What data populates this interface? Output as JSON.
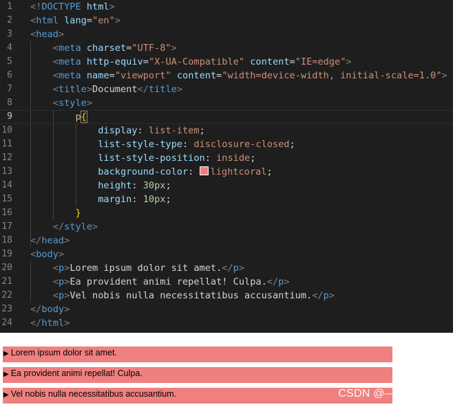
{
  "editor": {
    "lines": [
      {
        "n": "1",
        "tokens": [
          [
            "punct",
            "<!"
          ],
          [
            "tag",
            "DOCTYPE"
          ],
          [
            "txt",
            " "
          ],
          [
            "attr",
            "html"
          ],
          [
            "punct",
            ">"
          ]
        ]
      },
      {
        "n": "2",
        "tokens": [
          [
            "punct",
            "<"
          ],
          [
            "tag",
            "html"
          ],
          [
            "txt",
            " "
          ],
          [
            "attr",
            "lang"
          ],
          [
            "txt",
            "="
          ],
          [
            "str",
            "\"en\""
          ],
          [
            "punct",
            ">"
          ]
        ]
      },
      {
        "n": "3",
        "tokens": [
          [
            "punct",
            "<"
          ],
          [
            "tag",
            "head"
          ],
          [
            "punct",
            ">"
          ]
        ]
      },
      {
        "n": "4",
        "tokens": [
          [
            "txt",
            "    "
          ],
          [
            "punct",
            "<"
          ],
          [
            "tag",
            "meta"
          ],
          [
            "txt",
            " "
          ],
          [
            "attr",
            "charset"
          ],
          [
            "txt",
            "="
          ],
          [
            "str",
            "\"UTF-8\""
          ],
          [
            "punct",
            ">"
          ]
        ]
      },
      {
        "n": "5",
        "tokens": [
          [
            "txt",
            "    "
          ],
          [
            "punct",
            "<"
          ],
          [
            "tag",
            "meta"
          ],
          [
            "txt",
            " "
          ],
          [
            "attr",
            "http-equiv"
          ],
          [
            "txt",
            "="
          ],
          [
            "str",
            "\"X-UA-Compatible\""
          ],
          [
            "txt",
            " "
          ],
          [
            "attr",
            "content"
          ],
          [
            "txt",
            "="
          ],
          [
            "str",
            "\"IE=edge\""
          ],
          [
            "punct",
            ">"
          ]
        ]
      },
      {
        "n": "6",
        "tokens": [
          [
            "txt",
            "    "
          ],
          [
            "punct",
            "<"
          ],
          [
            "tag",
            "meta"
          ],
          [
            "txt",
            " "
          ],
          [
            "attr",
            "name"
          ],
          [
            "txt",
            "="
          ],
          [
            "str",
            "\"viewport\""
          ],
          [
            "txt",
            " "
          ],
          [
            "attr",
            "content"
          ],
          [
            "txt",
            "="
          ],
          [
            "str",
            "\"width=device-width, initial-scale=1.0\""
          ],
          [
            "punct",
            ">"
          ]
        ]
      },
      {
        "n": "7",
        "tokens": [
          [
            "txt",
            "    "
          ],
          [
            "punct",
            "<"
          ],
          [
            "tag",
            "title"
          ],
          [
            "punct",
            ">"
          ],
          [
            "txt",
            "Document"
          ],
          [
            "punct",
            "</"
          ],
          [
            "tag",
            "title"
          ],
          [
            "punct",
            ">"
          ]
        ]
      },
      {
        "n": "8",
        "tokens": [
          [
            "txt",
            "    "
          ],
          [
            "punct",
            "<"
          ],
          [
            "tag",
            "style"
          ],
          [
            "punct",
            ">"
          ]
        ]
      },
      {
        "n": "9",
        "tokens": [
          [
            "txt",
            "        "
          ],
          [
            "sel",
            "p"
          ],
          [
            "brace",
            "{"
          ]
        ]
      },
      {
        "n": "10",
        "tokens": [
          [
            "txt",
            "            "
          ],
          [
            "prop",
            "display"
          ],
          [
            "txt",
            ": "
          ],
          [
            "val",
            "list-item"
          ],
          [
            "txt",
            ";"
          ]
        ]
      },
      {
        "n": "11",
        "tokens": [
          [
            "txt",
            "            "
          ],
          [
            "prop",
            "list-style-type"
          ],
          [
            "txt",
            ": "
          ],
          [
            "val",
            "disclosure-closed"
          ],
          [
            "txt",
            ";"
          ]
        ]
      },
      {
        "n": "12",
        "tokens": [
          [
            "txt",
            "            "
          ],
          [
            "prop",
            "list-style-position"
          ],
          [
            "txt",
            ": "
          ],
          [
            "val",
            "inside"
          ],
          [
            "txt",
            ";"
          ]
        ]
      },
      {
        "n": "13",
        "tokens": [
          [
            "txt",
            "            "
          ],
          [
            "prop",
            "background-color"
          ],
          [
            "txt",
            ": "
          ],
          [
            "swatch",
            ""
          ],
          [
            "val",
            "lightcoral"
          ],
          [
            "txt",
            ";"
          ]
        ]
      },
      {
        "n": "14",
        "tokens": [
          [
            "txt",
            "            "
          ],
          [
            "prop",
            "height"
          ],
          [
            "txt",
            ": "
          ],
          [
            "num",
            "30px"
          ],
          [
            "txt",
            ";"
          ]
        ]
      },
      {
        "n": "15",
        "tokens": [
          [
            "txt",
            "            "
          ],
          [
            "prop",
            "margin"
          ],
          [
            "txt",
            ": "
          ],
          [
            "num",
            "10px"
          ],
          [
            "txt",
            ";"
          ]
        ]
      },
      {
        "n": "16",
        "tokens": [
          [
            "txt",
            "        "
          ],
          [
            "brace",
            "}"
          ]
        ]
      },
      {
        "n": "17",
        "tokens": [
          [
            "txt",
            "    "
          ],
          [
            "punct",
            "</"
          ],
          [
            "tag",
            "style"
          ],
          [
            "punct",
            ">"
          ]
        ]
      },
      {
        "n": "18",
        "tokens": [
          [
            "punct",
            "</"
          ],
          [
            "tag",
            "head"
          ],
          [
            "punct",
            ">"
          ]
        ]
      },
      {
        "n": "19",
        "tokens": [
          [
            "punct",
            "<"
          ],
          [
            "tag",
            "body"
          ],
          [
            "punct",
            ">"
          ]
        ]
      },
      {
        "n": "20",
        "tokens": [
          [
            "txt",
            "    "
          ],
          [
            "punct",
            "<"
          ],
          [
            "tag",
            "p"
          ],
          [
            "punct",
            ">"
          ],
          [
            "txt",
            "Lorem ipsum dolor sit amet."
          ],
          [
            "punct",
            "</"
          ],
          [
            "tag",
            "p"
          ],
          [
            "punct",
            ">"
          ]
        ]
      },
      {
        "n": "21",
        "tokens": [
          [
            "txt",
            "    "
          ],
          [
            "punct",
            "<"
          ],
          [
            "tag",
            "p"
          ],
          [
            "punct",
            ">"
          ],
          [
            "txt",
            "Ea provident animi repellat! Culpa."
          ],
          [
            "punct",
            "</"
          ],
          [
            "tag",
            "p"
          ],
          [
            "punct",
            ">"
          ]
        ]
      },
      {
        "n": "22",
        "tokens": [
          [
            "txt",
            "    "
          ],
          [
            "punct",
            "<"
          ],
          [
            "tag",
            "p"
          ],
          [
            "punct",
            ">"
          ],
          [
            "txt",
            "Vel nobis nulla necessitatibus accusantium."
          ],
          [
            "punct",
            "</"
          ],
          [
            "tag",
            "p"
          ],
          [
            "punct",
            ">"
          ]
        ]
      },
      {
        "n": "23",
        "tokens": [
          [
            "punct",
            "</"
          ],
          [
            "tag",
            "body"
          ],
          [
            "punct",
            ">"
          ]
        ]
      },
      {
        "n": "24",
        "tokens": [
          [
            "punct",
            "</"
          ],
          [
            "tag",
            "html"
          ],
          [
            "punct",
            ">"
          ]
        ]
      }
    ],
    "active_line": "9",
    "swatch_color": "#f08080"
  },
  "preview": {
    "marker": "▶",
    "background_color": "#f08080",
    "paragraphs": [
      "Lorem ipsum dolor sit amet.",
      "Ea provident animi repellat! Culpa.",
      "Vel nobis nulla necessitatibus accusantium."
    ]
  },
  "watermark": "CSDN @—Miss. Z—"
}
